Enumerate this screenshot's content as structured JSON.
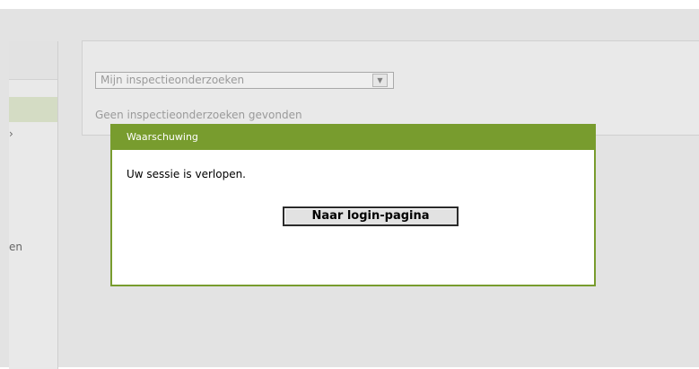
{
  "sidebar": {
    "fragment_1": "›",
    "fragment_2": "en"
  },
  "filter": {
    "selected_value": "Mijn inspectieonderzoeken",
    "arrow_icon": "▼"
  },
  "results": {
    "empty_message": "Geen inspectieonderzoeken gevonden"
  },
  "dialog": {
    "title": "Waarschuwing",
    "message": "Uw sessie is verlopen.",
    "login_button_label": "Naar login-pagina"
  },
  "colors": {
    "dialog_accent": "#789c2e",
    "backdrop": "#e3e3e3",
    "sidebar_selected": "#d4dcc4"
  }
}
